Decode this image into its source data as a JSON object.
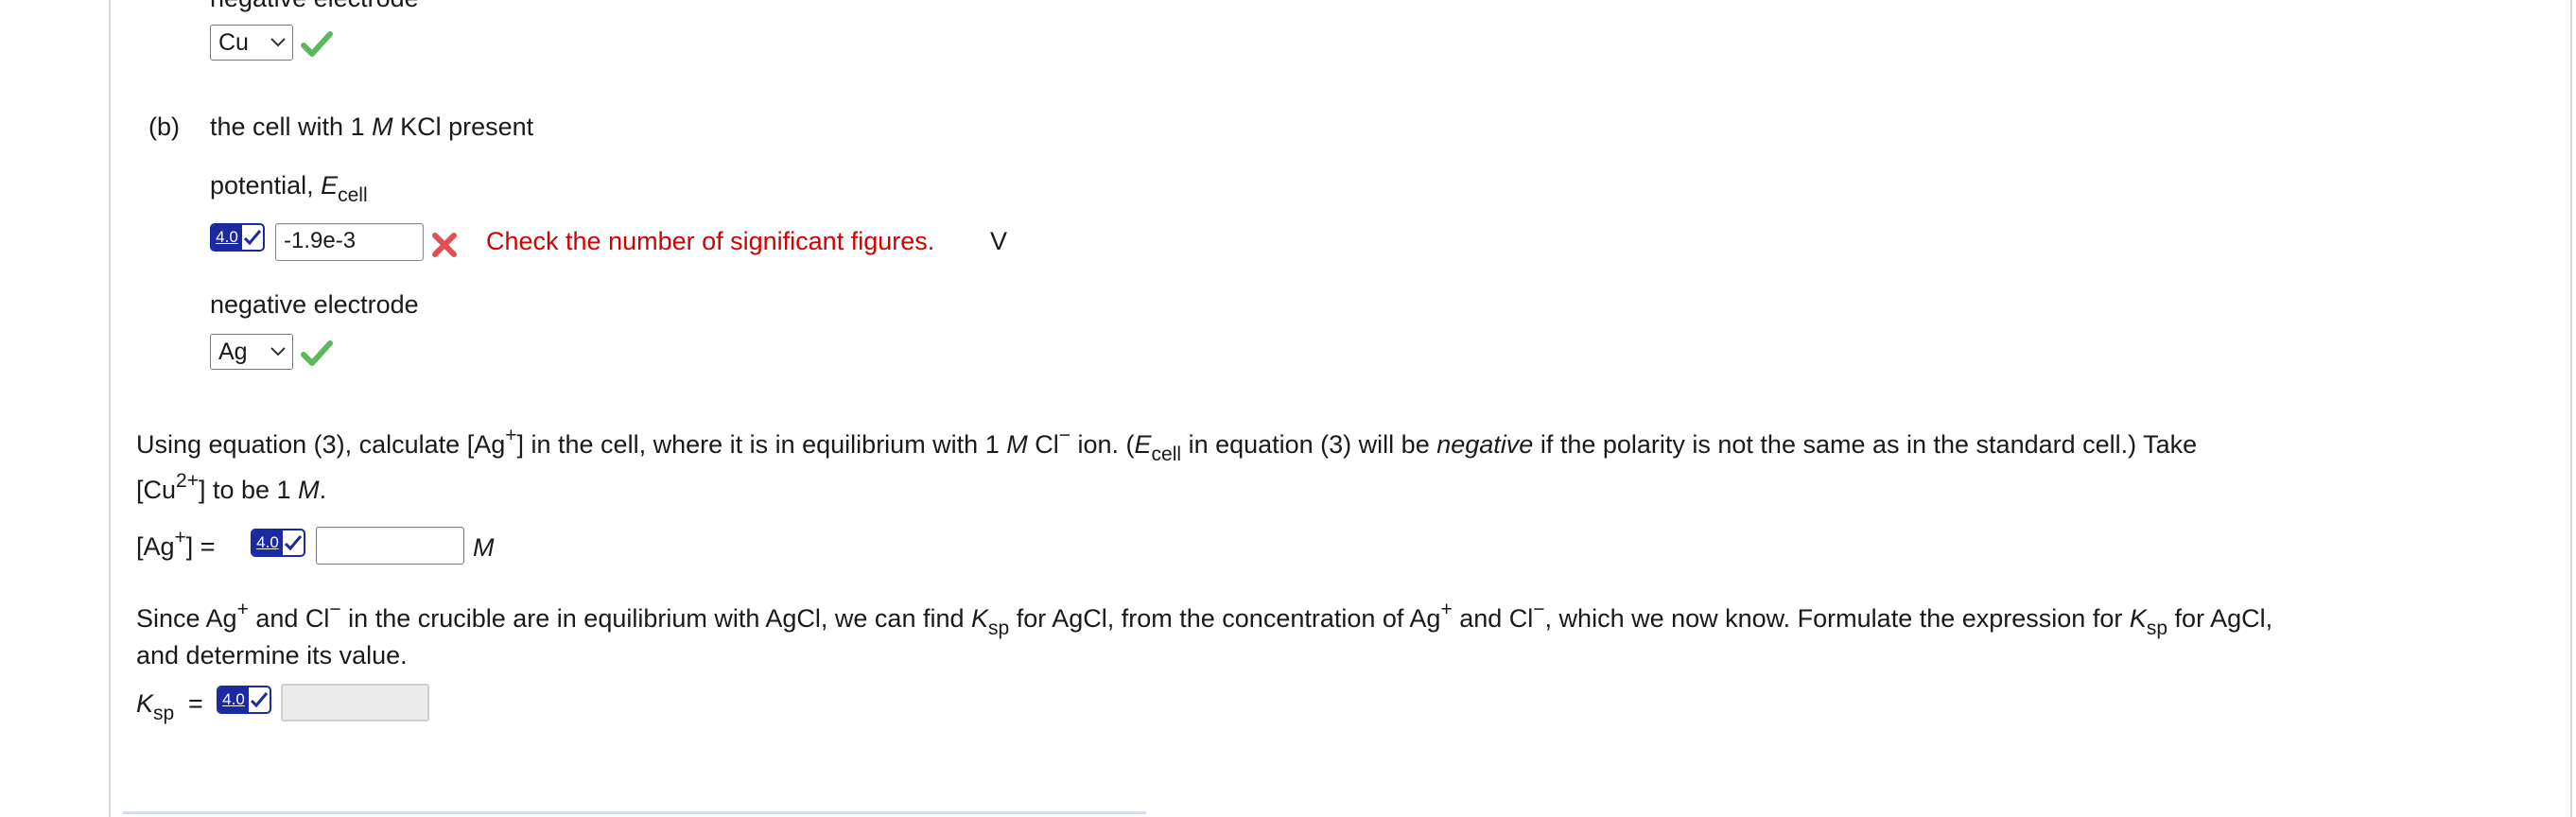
{
  "top": {
    "clipped_heading": "negative electrode",
    "select_value": "Cu"
  },
  "part_b": {
    "label": "(b)",
    "prompt_pre": "the cell with 1 ",
    "prompt_M": "M",
    "prompt_post": " KCl present",
    "potential_label": "potential, ",
    "potential_E": "E",
    "potential_sub": "cell",
    "badge": "4.0",
    "potential_value": "-1.9e-3",
    "error_message": "Check the number of significant figures.",
    "unit_V": "V",
    "neg_electrode_label": "negative electrode",
    "neg_electrode_value": "Ag"
  },
  "question1": {
    "line1_a": "Using equation (3), calculate [Ag",
    "line1_sup": "+",
    "line1_b": "] in the cell, where it is in equilibrium with 1 ",
    "line1_M": "M",
    "line1_c": " Cl",
    "line1_sup2": "−",
    "line1_d": " ion. (",
    "line1_E": "E",
    "line1_sub": "cell",
    "line1_e": " in equation (3) will be ",
    "line1_neg": "negative",
    "line1_f": " if the polarity is not the same as in the standard cell.) Take",
    "line2_a": "[Cu",
    "line2_sup": "2+",
    "line2_b": "] to be 1 ",
    "line2_M": "M",
    "line2_c": ".",
    "answer_lhs_a": "[Ag",
    "answer_lhs_sup": "+",
    "answer_lhs_b": "] =",
    "badge": "4.0",
    "answer_value": "",
    "unit": "M"
  },
  "question2": {
    "line1_a": "Since Ag",
    "line1_sup": "+",
    "line1_b": " and Cl",
    "line1_sup2": "−",
    "line1_c": " in the crucible are in equilibrium with AgCl, we can find ",
    "line1_K": "K",
    "line1_sub": "sp",
    "line1_d": " for AgCl, from the concentration of Ag",
    "line1_sup3": "+",
    "line1_e": " and Cl",
    "line1_sup4": "−",
    "line1_f": ", which we now know. Formulate the expression for ",
    "line1_K2": "K",
    "line1_sub2": "sp",
    "line1_g": " for AgCl,",
    "line2": "and determine its value.",
    "ksp_K": "K",
    "ksp_sub": "sp",
    "ksp_eq": "=",
    "badge": "4.0",
    "ksp_value": ""
  },
  "colors": {
    "correct": "#5cb85c",
    "incorrect": "#e05050",
    "error_text": "#d40000",
    "badge": "#1b2aa0"
  }
}
